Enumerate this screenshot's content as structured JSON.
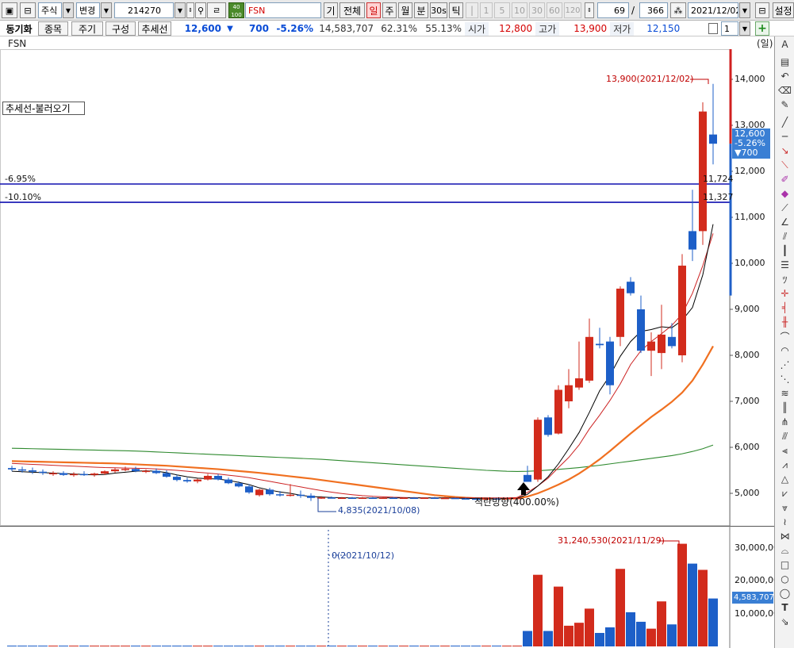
{
  "toolbar": {
    "market_type": "주식",
    "change_label": "변경",
    "stock_code": "214270",
    "badge_top": "40",
    "badge_bottom": "100",
    "stock_name": "FSN",
    "btn_base": "기",
    "btn_all": "전체",
    "periods": [
      "일",
      "주",
      "월",
      "분",
      "30s",
      "틱"
    ],
    "selected_period": "일",
    "minute_options": [
      "1",
      "5",
      "10",
      "30",
      "60",
      "120"
    ],
    "count_value": "69",
    "slash": "/",
    "total_value": "366",
    "date_value": "2021/12/02",
    "settings_label": "설정"
  },
  "subbar": {
    "sync_label": "동기화",
    "item_label": "종목",
    "period_label": "주기",
    "compose_label": "구성",
    "trend_label": "추세선",
    "price": "12,600",
    "arrow": "▼",
    "change": "700",
    "change_pct": "-5.26%",
    "volume": "14,583,707",
    "ratio1": "62.31%",
    "ratio2": "55.13%",
    "open_label": "시가",
    "open_value": "12,800",
    "high_label": "고가",
    "high_value": "13,900",
    "low_label": "저가",
    "low_value": "12,150",
    "spin_value": "1"
  },
  "chart": {
    "title": "FSN",
    "unit": "(일)",
    "trend_box": "추세선-불러오기",
    "line1_label": "-6.95%",
    "line1_value": "11,724",
    "line2_label": "-10.10%",
    "line2_value": "11,327",
    "high_annotation": "13,900(2021/12/02)",
    "low_annotation": "4,835(2021/10/08)",
    "pattern_annotation": "적란방향(400.00%)",
    "current_tag": {
      "price": "12,600",
      "pct": "-5.26%",
      "chg": "▼700"
    },
    "price_scale": [
      "14,000",
      "13,000",
      "12,000",
      "11,000",
      "10,000",
      "9,000",
      "8,000",
      "7,000",
      "6,000",
      "5,000"
    ],
    "volume_scale": [
      "30,000,000",
      "20,000,000",
      "10,000,000"
    ],
    "volume_current": "4,583,707",
    "volume_high_annotation": "31,240,530(2021/11/29)",
    "volume_zero_annotation": "0(2021/10/12)"
  },
  "chart_data": {
    "type": "candlestick",
    "price_range": [
      4500,
      14600
    ],
    "volume_range": [
      0,
      35000000
    ],
    "candles": [
      {
        "o": 5550,
        "h": 5600,
        "l": 5480,
        "c": 5520
      },
      {
        "o": 5520,
        "h": 5580,
        "l": 5450,
        "c": 5500
      },
      {
        "o": 5500,
        "h": 5560,
        "l": 5420,
        "c": 5470
      },
      {
        "o": 5470,
        "h": 5520,
        "l": 5400,
        "c": 5450
      },
      {
        "o": 5420,
        "h": 5480,
        "l": 5380,
        "c": 5440
      },
      {
        "o": 5440,
        "h": 5480,
        "l": 5380,
        "c": 5400
      },
      {
        "o": 5400,
        "h": 5460,
        "l": 5360,
        "c": 5420
      },
      {
        "o": 5420,
        "h": 5480,
        "l": 5380,
        "c": 5400
      },
      {
        "o": 5400,
        "h": 5450,
        "l": 5360,
        "c": 5430
      },
      {
        "o": 5430,
        "h": 5500,
        "l": 5400,
        "c": 5480
      },
      {
        "o": 5480,
        "h": 5560,
        "l": 5450,
        "c": 5520
      },
      {
        "o": 5520,
        "h": 5580,
        "l": 5480,
        "c": 5530
      },
      {
        "o": 5530,
        "h": 5580,
        "l": 5460,
        "c": 5480
      },
      {
        "o": 5480,
        "h": 5520,
        "l": 5440,
        "c": 5490
      },
      {
        "o": 5490,
        "h": 5540,
        "l": 5420,
        "c": 5440
      },
      {
        "o": 5440,
        "h": 5500,
        "l": 5340,
        "c": 5360
      },
      {
        "o": 5360,
        "h": 5400,
        "l": 5260,
        "c": 5290
      },
      {
        "o": 5290,
        "h": 5340,
        "l": 5230,
        "c": 5260
      },
      {
        "o": 5260,
        "h": 5320,
        "l": 5220,
        "c": 5300
      },
      {
        "o": 5300,
        "h": 5420,
        "l": 5280,
        "c": 5380
      },
      {
        "o": 5380,
        "h": 5420,
        "l": 5280,
        "c": 5300
      },
      {
        "o": 5300,
        "h": 5340,
        "l": 5200,
        "c": 5220
      },
      {
        "o": 5220,
        "h": 5260,
        "l": 5130,
        "c": 5150
      },
      {
        "o": 5150,
        "h": 5200,
        "l": 4990,
        "c": 5020
      },
      {
        "o": 4960,
        "h": 5100,
        "l": 4930,
        "c": 5080
      },
      {
        "o": 5080,
        "h": 5120,
        "l": 4950,
        "c": 4980
      },
      {
        "o": 4980,
        "h": 5050,
        "l": 4930,
        "c": 4960
      },
      {
        "o": 4960,
        "h": 5200,
        "l": 4930,
        "c": 4970
      },
      {
        "o": 4970,
        "h": 5060,
        "l": 4900,
        "c": 4950
      },
      {
        "o": 4950,
        "h": 5000,
        "l": 4835,
        "c": 4900
      },
      {
        "o": 4900,
        "h": 4940,
        "l": 4880,
        "c": 4910
      },
      {
        "o": 4910,
        "h": 4930,
        "l": 4890,
        "c": 4900
      },
      {
        "o": 4900,
        "h": 4920,
        "l": 4880,
        "c": 4905
      },
      {
        "o": 4905,
        "h": 4920,
        "l": 4890,
        "c": 4895
      },
      {
        "o": 4895,
        "h": 4920,
        "l": 4880,
        "c": 4905
      },
      {
        "o": 4905,
        "h": 4920,
        "l": 4890,
        "c": 4900
      },
      {
        "o": 4900,
        "h": 4920,
        "l": 4885,
        "c": 4905
      },
      {
        "o": 4905,
        "h": 4920,
        "l": 4890,
        "c": 4900
      },
      {
        "o": 4900,
        "h": 4915,
        "l": 4885,
        "c": 4905
      },
      {
        "o": 4905,
        "h": 4920,
        "l": 4890,
        "c": 4895
      },
      {
        "o": 4895,
        "h": 4915,
        "l": 4880,
        "c": 4905
      },
      {
        "o": 4905,
        "h": 4920,
        "l": 4890,
        "c": 4900
      },
      {
        "o": 4900,
        "h": 4920,
        "l": 4885,
        "c": 4900
      },
      {
        "o": 4900,
        "h": 4910,
        "l": 4880,
        "c": 4890
      },
      {
        "o": 4890,
        "h": 4905,
        "l": 4870,
        "c": 4885
      },
      {
        "o": 4885,
        "h": 4900,
        "l": 4870,
        "c": 4880
      },
      {
        "o": 4880,
        "h": 4895,
        "l": 4860,
        "c": 4890
      },
      {
        "o": 4890,
        "h": 4900,
        "l": 4870,
        "c": 4880
      },
      {
        "o": 4880,
        "h": 4900,
        "l": 4860,
        "c": 4895
      },
      {
        "o": 4895,
        "h": 4920,
        "l": 4880,
        "c": 4900
      },
      {
        "o": 5400,
        "h": 5600,
        "l": 5250,
        "c": 5250
      },
      {
        "o": 5300,
        "h": 6650,
        "l": 5250,
        "c": 6600
      },
      {
        "o": 6650,
        "h": 6700,
        "l": 6230,
        "c": 6270
      },
      {
        "o": 6300,
        "h": 7350,
        "l": 6280,
        "c": 7250
      },
      {
        "o": 7000,
        "h": 7700,
        "l": 6850,
        "c": 7350
      },
      {
        "o": 7300,
        "h": 8300,
        "l": 7250,
        "c": 7500
      },
      {
        "o": 7450,
        "h": 8800,
        "l": 7400,
        "c": 8400
      },
      {
        "o": 8250,
        "h": 8600,
        "l": 8150,
        "c": 8220
      },
      {
        "o": 8300,
        "h": 8400,
        "l": 7150,
        "c": 7350
      },
      {
        "o": 8400,
        "h": 9500,
        "l": 8200,
        "c": 9450
      },
      {
        "o": 9600,
        "h": 9700,
        "l": 9300,
        "c": 9350
      },
      {
        "o": 9000,
        "h": 9300,
        "l": 8050,
        "c": 8100
      },
      {
        "o": 8100,
        "h": 8500,
        "l": 7550,
        "c": 8300
      },
      {
        "o": 8050,
        "h": 9100,
        "l": 7700,
        "c": 8450
      },
      {
        "o": 8400,
        "h": 8700,
        "l": 8150,
        "c": 8200
      },
      {
        "o": 8000,
        "h": 10200,
        "l": 7850,
        "c": 9950
      },
      {
        "o": 10700,
        "h": 11600,
        "l": 10050,
        "c": 10300
      },
      {
        "o": 10700,
        "h": 13500,
        "l": 10400,
        "c": 13300
      },
      {
        "o": 12800,
        "h": 13900,
        "l": 12150,
        "c": 12600
      }
    ],
    "volumes": [
      200000,
      150000,
      180000,
      120000,
      160000,
      140000,
      130000,
      120000,
      110000,
      170000,
      200000,
      160000,
      150000,
      120000,
      140000,
      180000,
      190000,
      150000,
      120000,
      200000,
      160000,
      140000,
      150000,
      180000,
      170000,
      130000,
      110000,
      120000,
      100000,
      140000,
      0,
      0,
      0,
      0,
      0,
      0,
      0,
      0,
      0,
      0,
      0,
      0,
      0,
      0,
      0,
      0,
      0,
      0,
      0,
      0,
      4700000,
      21800000,
      4700000,
      18200000,
      6300000,
      7200000,
      11500000,
      4100000,
      5800000,
      23600000,
      10400000,
      7500000,
      5400000,
      13700000,
      6700000,
      31240530,
      25200000,
      23300000,
      14583707
    ],
    "ma5": [
      5480,
      5470,
      5460,
      5450,
      5440,
      5430,
      5420,
      5410,
      5400,
      5410,
      5440,
      5460,
      5480,
      5490,
      5480,
      5450,
      5400,
      5360,
      5330,
      5320,
      5310,
      5280,
      5240,
      5190,
      5120,
      5070,
      5030,
      5000,
      4960,
      4930,
      4920,
      4910,
      4905,
      4900,
      4900,
      4900,
      4900,
      4900,
      4900,
      4900,
      4900,
      4900,
      4900,
      4895,
      4890,
      4885,
      4880,
      4880,
      4885,
      4890,
      4980,
      5160,
      5360,
      5640,
      5970,
      6320,
      6760,
      7230,
      7560,
      7980,
      8300,
      8520,
      8560,
      8620,
      8600,
      8760,
      9040,
      9750,
      10850
    ],
    "ma10": [
      5650,
      5640,
      5630,
      5620,
      5610,
      5600,
      5590,
      5580,
      5570,
      5560,
      5555,
      5550,
      5545,
      5540,
      5530,
      5515,
      5500,
      5480,
      5460,
      5440,
      5420,
      5395,
      5370,
      5340,
      5300,
      5260,
      5220,
      5180,
      5140,
      5100,
      5060,
      5025,
      4995,
      4970,
      4950,
      4935,
      4925,
      4915,
      4910,
      4905,
      4900,
      4900,
      4900,
      4900,
      4900,
      4900,
      4900,
      4900,
      4900,
      4910,
      5020,
      5160,
      5330,
      5560,
      5780,
      6050,
      6400,
      6700,
      7020,
      7380,
      7800,
      8100,
      8300,
      8470,
      8650,
      8900,
      9350,
      9950,
      10650
    ],
    "ma20": [
      5700,
      5695,
      5690,
      5685,
      5680,
      5675,
      5670,
      5665,
      5660,
      5655,
      5650,
      5640,
      5630,
      5620,
      5610,
      5600,
      5585,
      5570,
      5555,
      5540,
      5525,
      5505,
      5485,
      5465,
      5445,
      5420,
      5395,
      5370,
      5345,
      5320,
      5290,
      5260,
      5230,
      5200,
      5170,
      5140,
      5110,
      5080,
      5050,
      5020,
      4990,
      4960,
      4940,
      4920,
      4905,
      4895,
      4890,
      4885,
      4885,
      4890,
      4930,
      5000,
      5090,
      5190,
      5300,
      5430,
      5580,
      5740,
      5920,
      6110,
      6300,
      6480,
      6660,
      6820,
      6990,
      7190,
      7450,
      7800,
      8200
    ],
    "ma60": [
      5980,
      5975,
      5970,
      5965,
      5960,
      5955,
      5950,
      5945,
      5940,
      5935,
      5930,
      5925,
      5920,
      5910,
      5900,
      5890,
      5880,
      5870,
      5860,
      5850,
      5840,
      5830,
      5820,
      5810,
      5800,
      5790,
      5780,
      5770,
      5760,
      5750,
      5740,
      5725,
      5710,
      5695,
      5680,
      5665,
      5650,
      5635,
      5620,
      5605,
      5590,
      5575,
      5560,
      5545,
      5530,
      5515,
      5500,
      5490,
      5480,
      5475,
      5480,
      5490,
      5505,
      5520,
      5540,
      5560,
      5585,
      5610,
      5640,
      5670,
      5700,
      5730,
      5760,
      5790,
      5820,
      5860,
      5910,
      5970,
      6050
    ]
  }
}
